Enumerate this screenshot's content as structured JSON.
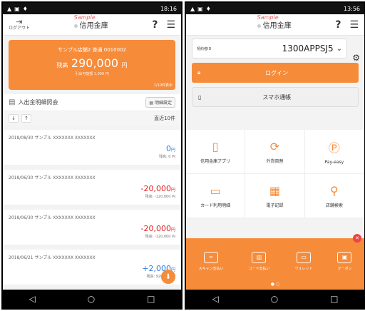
{
  "status_left": {
    "time": "18:16"
  },
  "status_right": {
    "time": "13:56"
  },
  "brand": {
    "sample_tag": "Sample",
    "name": "信用金庫"
  },
  "left": {
    "logout_label": "ログアウト",
    "account": {
      "name": "サンプル店舗2 普通 0010002",
      "balance_prefix": "残高",
      "balance": "290,000",
      "balance_suffix": "円",
      "available": "引出可能額 1,000 円",
      "pager": "1/10件表示"
    },
    "section_title": "入出金明細照会",
    "settings_btn": "明細設定",
    "recent_label": "直近10件",
    "transactions": [
      {
        "date_desc": "2018/08/30 サンプル XXXXXXX XXXXXXX",
        "amount": "0",
        "unit": "円",
        "balance": "残高: 0 円",
        "color": "#2a7be4"
      },
      {
        "date_desc": "2018/06/30 サンプル XXXXXXX XXXXXXX",
        "amount": "-20,000",
        "unit": "円",
        "balance": "残高: -120,000 円",
        "color": "#e02020"
      },
      {
        "date_desc": "2018/06/30 サンプル XXXXXXX XXXXXXX",
        "amount": "-20,000",
        "unit": "円",
        "balance": "残高: -120,000 円",
        "color": "#e02020"
      },
      {
        "date_desc": "2018/06/21 サンプル XXXXXXX XXXXXXX",
        "amount": "+2,000",
        "unit": "円",
        "balance": "残高: 920,000 円",
        "color": "#2a7be4"
      }
    ]
  },
  "right": {
    "contract_label": "契約者ID",
    "contract_value": "1300APPSJ5",
    "login_label": "ログイン",
    "smartphone_label": "スマホ通帳",
    "tiles": [
      {
        "label": "信用金庫アプリ",
        "icon": "▯"
      },
      {
        "label": "外貨両替",
        "icon": "⟳"
      },
      {
        "label": "Pay-easy",
        "icon": "Ⓟ"
      },
      {
        "label": "カード利用明細",
        "icon": "▭"
      },
      {
        "label": "電子記録",
        "icon": "▦"
      },
      {
        "label": "店舗検索",
        "icon": "⚲"
      }
    ],
    "bottom_items": [
      {
        "label": "スキャン支払い",
        "icon": "⌗"
      },
      {
        "label": "コード支払い",
        "icon": "▥"
      },
      {
        "label": "ウォレット",
        "icon": "▭"
      },
      {
        "label": "クーポン",
        "icon": "▣"
      }
    ]
  },
  "colors": {
    "accent": "#f68b3a",
    "positive": "#2a7be4",
    "negative": "#e02020"
  }
}
